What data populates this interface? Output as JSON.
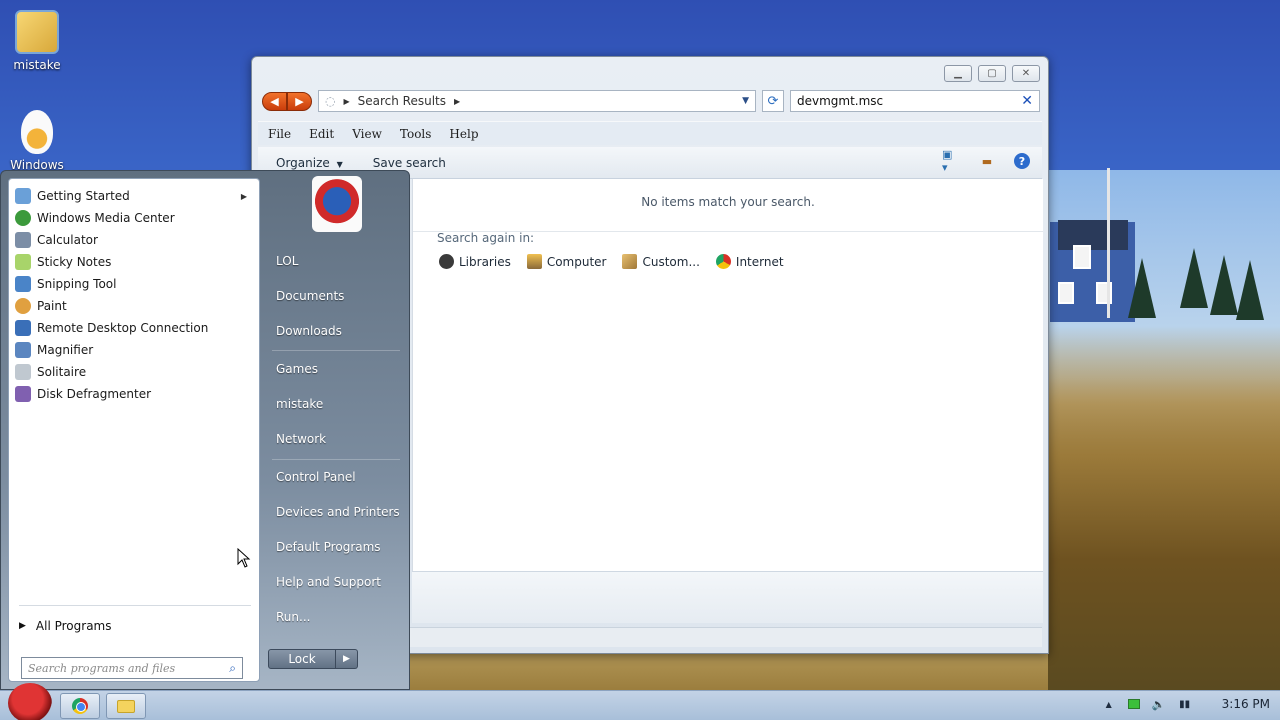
{
  "desktop": {
    "icons": [
      {
        "label": "mistake"
      },
      {
        "label": "Windows"
      }
    ]
  },
  "explorer": {
    "address": {
      "breadcrumb": "Search Results"
    },
    "search": {
      "value": "devmgmt.msc"
    },
    "menu": [
      "File",
      "Edit",
      "View",
      "Tools",
      "Help"
    ],
    "toolbar": {
      "organize": "Organize",
      "save_search": "Save search"
    },
    "content": {
      "no_items": "No items match your search.",
      "search_again_label": "Search again in:",
      "search_again": [
        {
          "label": "Libraries",
          "icon": "libraries-icon"
        },
        {
          "label": "Computer",
          "icon": "computer-icon"
        },
        {
          "label": "Custom...",
          "icon": "custom-icon"
        },
        {
          "label": "Internet",
          "icon": "internet-icon"
        }
      ]
    }
  },
  "start_menu": {
    "programs": [
      {
        "label": "Getting Started",
        "icon": "getting-started-icon",
        "color": "#6aa0d8"
      },
      {
        "label": "Windows Media Center",
        "icon": "media-center-icon",
        "color": "#3c9a3c"
      },
      {
        "label": "Calculator",
        "icon": "calculator-icon",
        "color": "#7c8ea6"
      },
      {
        "label": "Sticky Notes",
        "icon": "sticky-notes-icon",
        "color": "#a8d46a"
      },
      {
        "label": "Snipping Tool",
        "icon": "snipping-tool-icon",
        "color": "#4a84c8"
      },
      {
        "label": "Paint",
        "icon": "paint-icon",
        "color": "#e0a040"
      },
      {
        "label": "Remote Desktop Connection",
        "icon": "remote-desktop-icon",
        "color": "#3a6fb8"
      },
      {
        "label": "Magnifier",
        "icon": "magnifier-icon",
        "color": "#5b86c0"
      },
      {
        "label": "Solitaire",
        "icon": "solitaire-icon",
        "color": "#c0c8d0"
      },
      {
        "label": "Disk Defragmenter",
        "icon": "disk-defragmenter-icon",
        "color": "#8060b0"
      }
    ],
    "all_programs": "All Programs",
    "search_placeholder": "Search programs and files",
    "right_items": [
      "LOL",
      "Documents",
      "Downloads",
      "Games",
      "mistake",
      "Network",
      "Control Panel",
      "Devices and Printers",
      "Default Programs",
      "Help and Support",
      "Run..."
    ],
    "lock_label": "Lock"
  },
  "taskbar": {
    "clock": "3:16 PM"
  }
}
